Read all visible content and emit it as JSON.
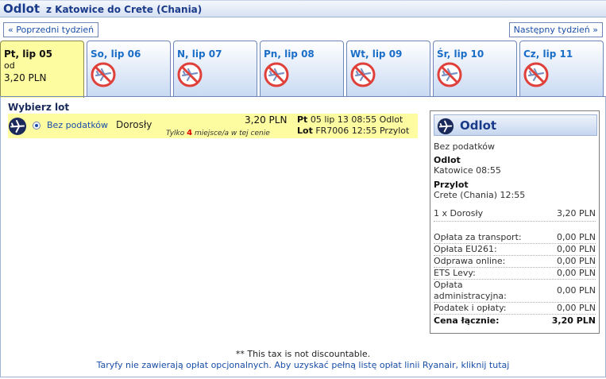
{
  "header": {
    "title": "Odlot",
    "route": "z Katowice do Crete (Chania)"
  },
  "nav": {
    "prev_label": "« Poprzedni tydzień",
    "next_label": "Następny tydzień »"
  },
  "tabs": [
    {
      "day": "Pt, lip 05",
      "od": "od",
      "price": "3,20 PLN",
      "active": true
    },
    {
      "day": "So, lip 06",
      "available": false
    },
    {
      "day": "N, lip 07",
      "available": false
    },
    {
      "day": "Pn, lip 08",
      "available": false
    },
    {
      "day": "Wt, lip 09",
      "available": false
    },
    {
      "day": "Śr, lip 10",
      "available": false
    },
    {
      "day": "Cz, lip 11",
      "available": false
    }
  ],
  "flight": {
    "choose_label": "Wybierz lot",
    "fare_label": "Bez podatków",
    "pax_label": "Dorosły",
    "price": "3,20 PLN",
    "seats_pre": "Tylko",
    "seats_count": "4",
    "seats_post": "miejsce/a w tej cenie",
    "depart_day": "Pt",
    "depart_text": "05 lip 13 08:55 Odlot",
    "lot_label": "Lot",
    "arrive_text": "FR7006 12:55 Przylot"
  },
  "summary": {
    "title": "Odlot",
    "fare": "Bez podatków",
    "depart_label": "Odlot",
    "depart_value": "Katowice 08:55",
    "arrive_label": "Przylot",
    "arrive_value": "Crete (Chania) 12:55",
    "pax_line": "1 x Dorosły",
    "pax_value": "3,20 PLN",
    "fees": [
      {
        "label": "Opłata za transport:",
        "value": "0,00 PLN"
      },
      {
        "label": "Opłata EU261:",
        "value": "0,00 PLN"
      },
      {
        "label": "Odprawa online:",
        "value": "0,00 PLN"
      },
      {
        "label": "ETS Levy:",
        "value": "0,00 PLN"
      },
      {
        "label": "Opłata",
        "label2": "administracyjna:",
        "value": "0,00 PLN"
      },
      {
        "label": "Podatek i opłaty:",
        "value": "0,00 PLN"
      }
    ],
    "total_label": "Cena łącznie:",
    "total_value": "3,20 PLN"
  },
  "footer": {
    "note": "** This tax is not discountable.",
    "link": "Taryfy nie zawierają opłat opcjonalnych. Aby uzyskać pełną listę opłat linii Ryanair, kliknij tutaj"
  },
  "colors": {
    "accent": "#1a3a8a",
    "link": "#1a4ea8",
    "highlight": "#fdfca0",
    "noflight": "#e0403a"
  }
}
